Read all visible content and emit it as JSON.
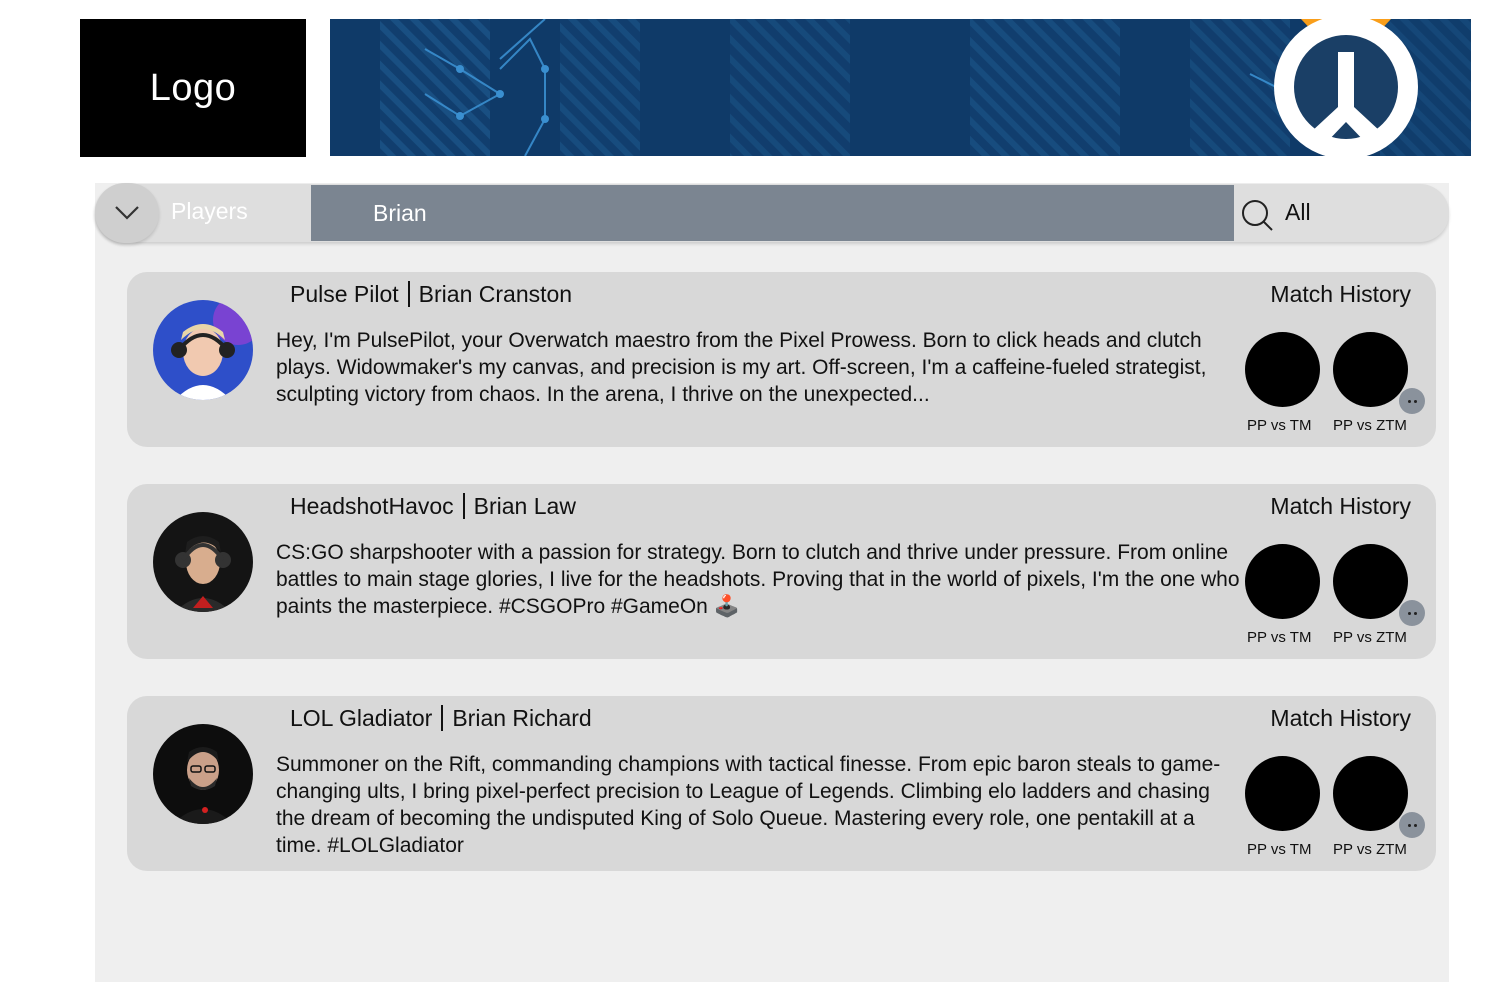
{
  "header": {
    "logo_text": "Logo"
  },
  "search": {
    "category": "Players",
    "query": "Brian",
    "filter": "All"
  },
  "colors": {
    "panel_bg": "#efefef",
    "card_bg": "#d8d8d8",
    "search_field_bg": "#7b8591",
    "banner_bg": "#0f3a68",
    "overwatch_orange": "#f99e1a"
  },
  "players": [
    {
      "gamertag": "Pulse Pilot",
      "name": "Brian Cranston",
      "bio": "Hey, I'm PulsePilot, your Overwatch maestro from the Pixel Prowess. Born to click heads and clutch plays. Widowmaker's my canvas, and precision is my art. Off-screen, I'm a caffeine-fueled strategist, sculpting victory from chaos. In the arena, I thrive on the unexpected...",
      "match_history_label": "Match History",
      "matches": [
        "PP vs TM",
        "PP vs ZTM"
      ]
    },
    {
      "gamertag": "HeadshotHavoc",
      "name": "Brian Law",
      "bio": "CS:GO sharpshooter with a passion for strategy. Born to clutch and thrive under pressure. From online battles to main stage glories, I live for the headshots. Proving that in the world of pixels, I'm the one who paints the masterpiece. #CSGOPro #GameOn 🕹️",
      "match_history_label": "Match History",
      "matches": [
        "PP vs TM",
        "PP vs ZTM"
      ]
    },
    {
      "gamertag": "LOL Gladiator",
      "name": "Brian Richard",
      "bio": "Summoner on the Rift, commanding champions with tactical finesse. From epic baron steals to game-changing ults, I bring pixel-perfect precision to League of Legends. Climbing elo ladders and chasing the dream of becoming the undisputed King of Solo Queue. Mastering every role, one pentakill at a time. #LOLGladiator",
      "match_history_label": "Match History",
      "matches": [
        "PP vs TM",
        "PP vs ZTM"
      ]
    }
  ]
}
